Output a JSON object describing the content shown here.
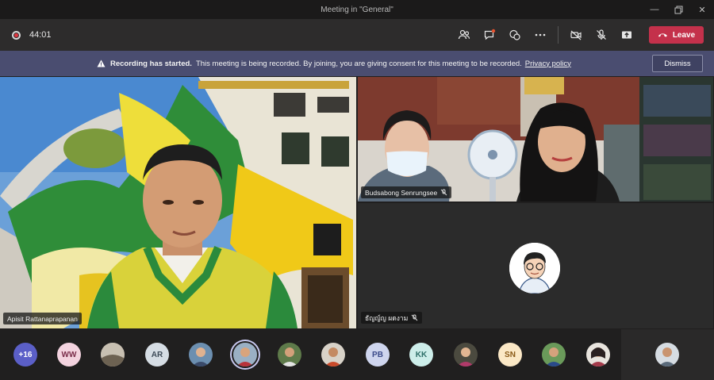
{
  "window": {
    "title": "Meeting in \"General\""
  },
  "toolbar": {
    "timer": "44:01",
    "leave_label": "Leave"
  },
  "banner": {
    "bold": "Recording has started.",
    "text": "This meeting is being recorded. By joining, you are giving consent for this meeting to be recorded.",
    "link": "Privacy policy",
    "dismiss_label": "Dismiss"
  },
  "tiles": {
    "main_name": "Apisit Rattanaprapanan",
    "top_right_name": "Budsabong Senrungsee",
    "bottom_right_name": "ธัญญ์ญ ผดงาม"
  },
  "participants": {
    "overflow": "+16",
    "initials": [
      "WW",
      "AR",
      "PB",
      "KK",
      "SN"
    ]
  },
  "colors": {
    "leave": "#c4314b",
    "banner": "#4a4d70",
    "overflow_badge": "#5b5fc7"
  }
}
